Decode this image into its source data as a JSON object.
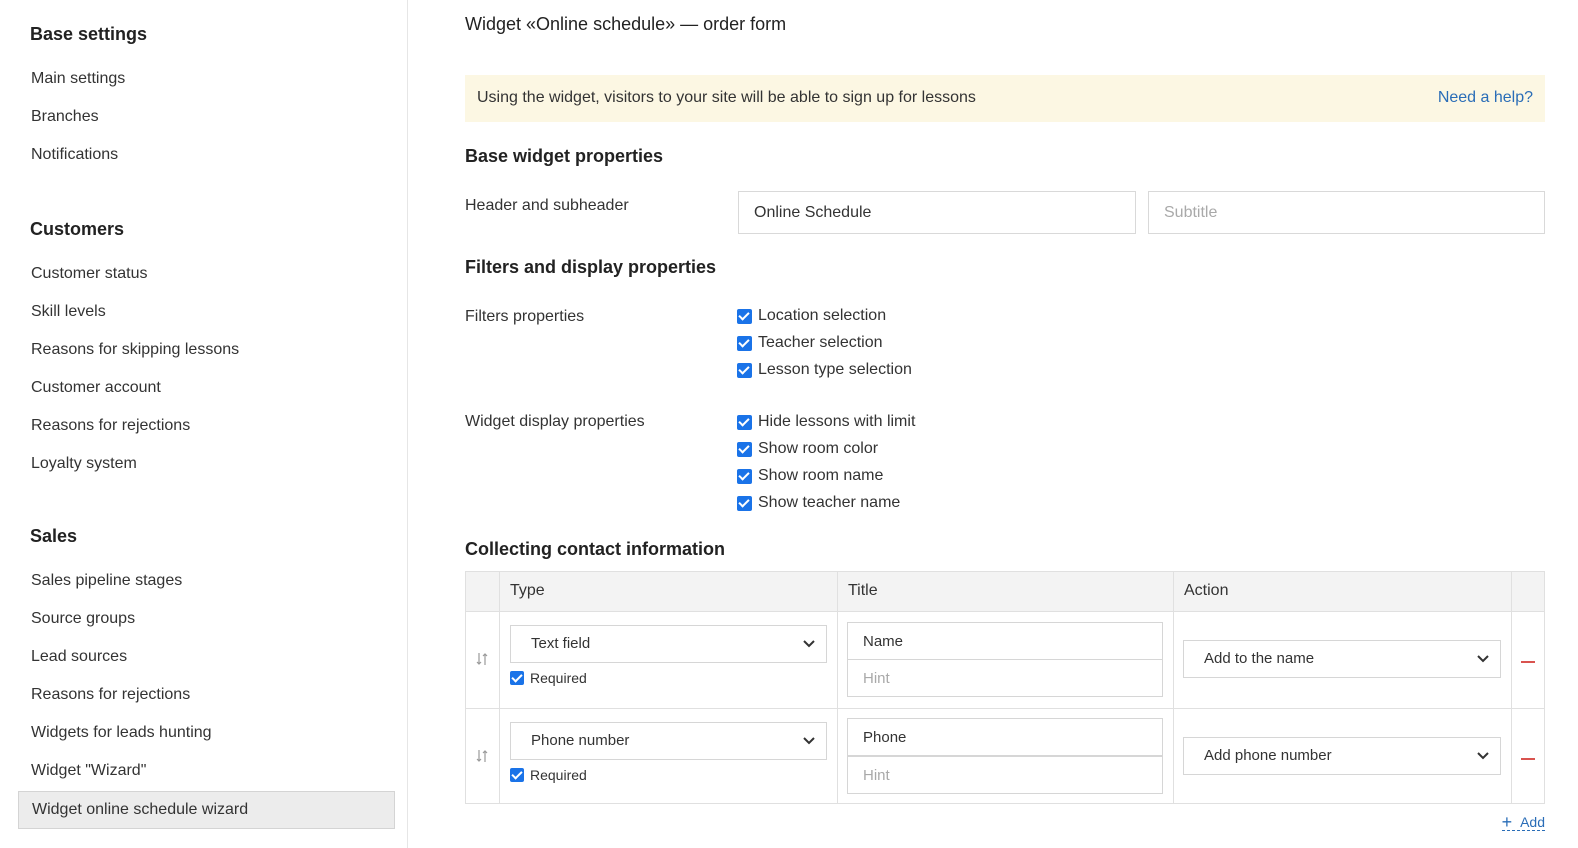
{
  "sidebar": {
    "groups": [
      {
        "title": "Base settings",
        "items": [
          "Main settings",
          "Branches",
          "Notifications"
        ]
      },
      {
        "title": "Customers",
        "items": [
          "Customer status",
          "Skill levels",
          "Reasons for skipping lessons",
          "Customer account",
          "Reasons for rejections",
          "Loyalty system"
        ]
      },
      {
        "title": "Sales",
        "items": [
          "Sales pipeline stages",
          "Source groups",
          "Lead sources",
          "Reasons for rejections",
          "Widgets for leads hunting",
          "Widget \"Wizard\"",
          "Widget online schedule wizard"
        ]
      }
    ],
    "active_item": "Widget online schedule wizard"
  },
  "main": {
    "title": "Widget «Online schedule» — order form",
    "banner": {
      "text": "Using the widget, visitors to your site will be able to sign up for lessons",
      "help_link": "Need a help?"
    },
    "base_props": {
      "section_title": "Base widget properties",
      "header_label": "Header and subheader",
      "header_value": "Online Schedule",
      "subtitle_value": "",
      "subtitle_placeholder": "Subtitle"
    },
    "filters": {
      "section_title": "Filters and display properties",
      "filters_label": "Filters properties",
      "filter_options": [
        {
          "label": "Location selection",
          "checked": true
        },
        {
          "label": "Teacher selection",
          "checked": true
        },
        {
          "label": "Lesson type selection",
          "checked": true
        }
      ],
      "display_label": "Widget display properties",
      "display_options": [
        {
          "label": "Hide lessons with limit",
          "checked": true
        },
        {
          "label": "Show room color",
          "checked": true
        },
        {
          "label": "Show room name",
          "checked": true
        },
        {
          "label": "Show teacher name",
          "checked": true
        }
      ]
    },
    "contact": {
      "section_title": "Collecting contact information",
      "columns": [
        "Type",
        "Title",
        "Action"
      ],
      "rows": [
        {
          "type": "Text field",
          "required_label": "Required",
          "required": true,
          "title": "Name",
          "hint_placeholder": "Hint",
          "action": "Add to the name"
        },
        {
          "type": "Phone number",
          "required_label": "Required",
          "required": true,
          "title": "Phone",
          "hint_placeholder": "Hint",
          "action": "Add phone number"
        }
      ],
      "add_label": "Add"
    }
  },
  "colors": {
    "accent": "#1a73e8",
    "link": "#2a6db7",
    "banner_bg": "#fcf7e3",
    "remove": "#d9534f"
  }
}
